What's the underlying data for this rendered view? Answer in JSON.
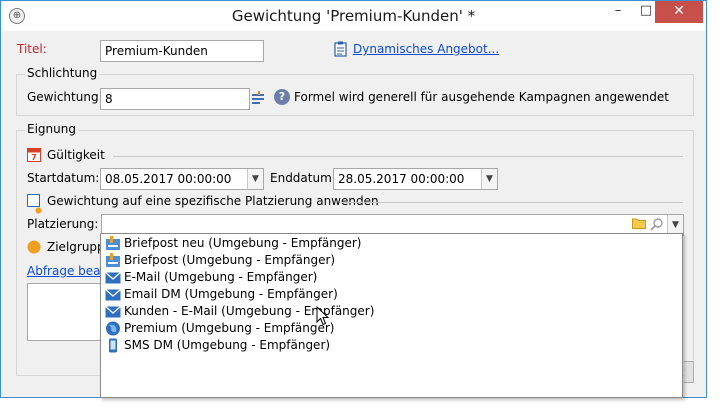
{
  "window": {
    "title": "Gewichtung 'Premium-Kunden' *",
    "minimize_glyph": "–",
    "maximize_glyph": "□",
    "close_glyph": "✕"
  },
  "form": {
    "title_label": "Titel:",
    "title_value": "Premium-Kunden",
    "offer_link": "Dynamisches Angebot...",
    "schlichtung": {
      "group_title": "Schlichtung",
      "weight_label": "Gewichtung:",
      "weight_value": "8",
      "formula_hint": "Formel wird generell für ausgehende Kampagnen angewendet"
    },
    "eignung": {
      "group_title": "Eignung",
      "validity_title": "Gültigkeit",
      "validity_calendar_day": "7",
      "start_label": "Startdatum:",
      "start_value": "08.05.2017 00:00:00",
      "end_label": "Enddatum:",
      "end_value": "28.05.2017 00:00:00",
      "placement_checkbox_label": "Gewichtung auf eine spezifische Platzierung anwenden",
      "placement_label": "Platzierung:",
      "placement_value": "",
      "target_group_label": "Zielgrupp",
      "edit_query_link": "Abfrage bearb"
    }
  },
  "dropdown": {
    "items": [
      {
        "label": "Briefpost  neu (Umgebung - Empfänger)",
        "icon": "mail-post-icon"
      },
      {
        "label": "Briefpost (Umgebung - Empfänger)",
        "icon": "mail-post-icon"
      },
      {
        "label": "E-Mail (Umgebung - Empfänger)",
        "icon": "envelope-icon"
      },
      {
        "label": "Email DM (Umgebung - Empfänger)",
        "icon": "envelope-icon"
      },
      {
        "label": "Kunden - E-Mail (Umgebung - Empfänger)",
        "icon": "envelope-icon"
      },
      {
        "label": "Premium (Umgebung - Empfänger)",
        "icon": "globe-icon"
      },
      {
        "label": "SMS DM (Umgebung - Empfänger)",
        "icon": "mobile-phone-icon"
      }
    ]
  },
  "colors": {
    "accent_link": "#0a4bd6",
    "label_red": "#c0262c",
    "close_button": "#c7504b",
    "window_border": "#3c8fd0",
    "calendar_red": "#d6402b",
    "target_orange": "#f0a020"
  }
}
